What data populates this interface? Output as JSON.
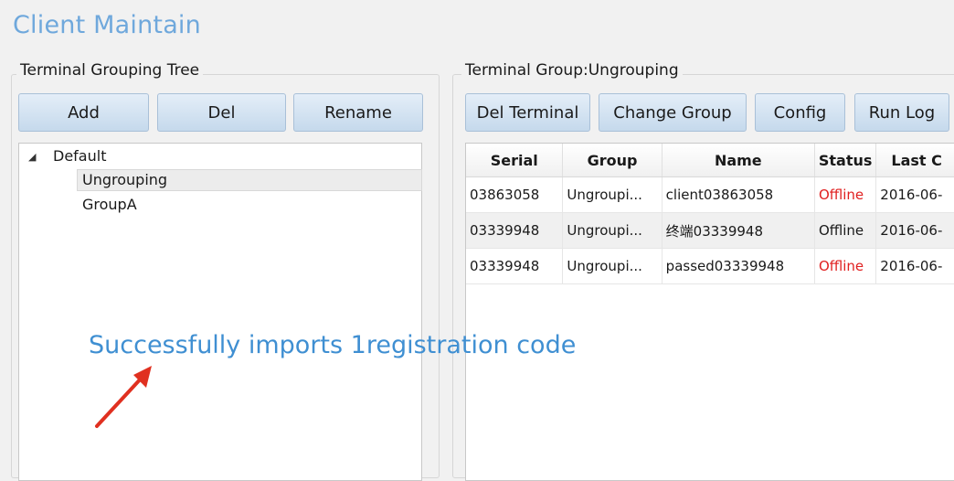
{
  "window": {
    "title": "Client Maintain"
  },
  "left_panel": {
    "legend": "Terminal Grouping Tree",
    "buttons": {
      "add": "Add",
      "del": "Del",
      "rename": "Rename"
    },
    "tree": {
      "root": "Default",
      "children": [
        "Ungrouping",
        "GroupA"
      ],
      "selected": "Ungrouping"
    }
  },
  "right_panel": {
    "legend": "Terminal Group:Ungrouping",
    "buttons": {
      "del_terminal": "Del Terminal",
      "change_group": "Change Group",
      "config": "Config",
      "run_log": "Run Log"
    },
    "table": {
      "columns": [
        "Serial",
        "Group",
        "Name",
        "Status",
        "Last C"
      ],
      "rows": [
        {
          "serial": "03863058",
          "group": "Ungroupi...",
          "name": "client03863058",
          "status": "Offline",
          "last": "2016-06-",
          "status_color": "#e02020"
        },
        {
          "serial": "03339948",
          "group": "Ungroupi...",
          "name": "终端03339948",
          "status": "Offline",
          "last": "2016-06-",
          "status_color": "#1a1a1a"
        },
        {
          "serial": "03339948",
          "group": "Ungroupi...",
          "name": "passed03339948",
          "status": "Offline",
          "last": "2016-06-",
          "status_color": "#e02020"
        }
      ]
    }
  },
  "annotation": {
    "text": "Successfully imports 1registration code",
    "color": "#3f8fd2",
    "arrow_color": "#e03020"
  }
}
